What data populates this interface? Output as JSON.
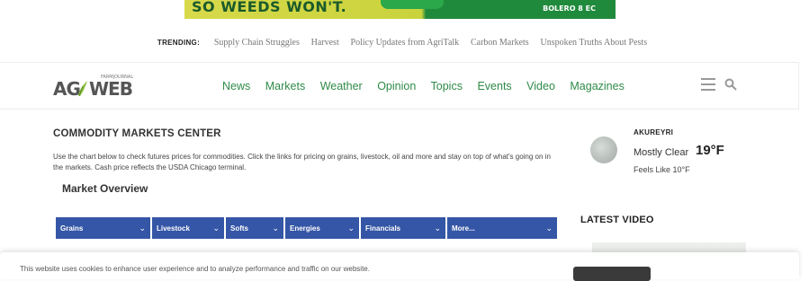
{
  "ad": {
    "headline": "SO WEEDS WON'T.",
    "brand": "BOLERO 8 EC"
  },
  "trending": {
    "label": "TRENDING:",
    "links": [
      "Supply Chain Struggles",
      "Harvest",
      "Policy Updates from AgriTalk",
      "Carbon Markets",
      "Unspoken Truths About Pests"
    ]
  },
  "header": {
    "logo": {
      "top_text": "FARMJOURNAL",
      "ag": "AG",
      "web": "WEB"
    },
    "nav": [
      "News",
      "Markets",
      "Weather",
      "Opinion",
      "Topics",
      "Events",
      "Video",
      "Magazines"
    ]
  },
  "main": {
    "title": "COMMODITY MARKETS CENTER",
    "description": "Use the chart below to check futures prices for commodities. Click the links for pricing on grains, livestock, oil and more and stay on top of what's going on in the markets. Cash price reflects the USDA Chicago terminal.",
    "overview_title": "Market Overview",
    "tabs": [
      "Grains",
      "Livestock",
      "Softs",
      "Energies",
      "Financials",
      "More..."
    ]
  },
  "weather": {
    "city": "AKUREYRI",
    "condition": "Mostly Clear",
    "temp": "19°F",
    "feels_like": "Feels Like  10°F"
  },
  "sidebar": {
    "latest_video": "LATEST VIDEO"
  },
  "cookie": {
    "text": "This website uses cookies to enhance user experience and to analyze performance and traffic on our website."
  },
  "colors": {
    "nav_green": "#2f8a48",
    "tab_blue": "#3556a6"
  }
}
